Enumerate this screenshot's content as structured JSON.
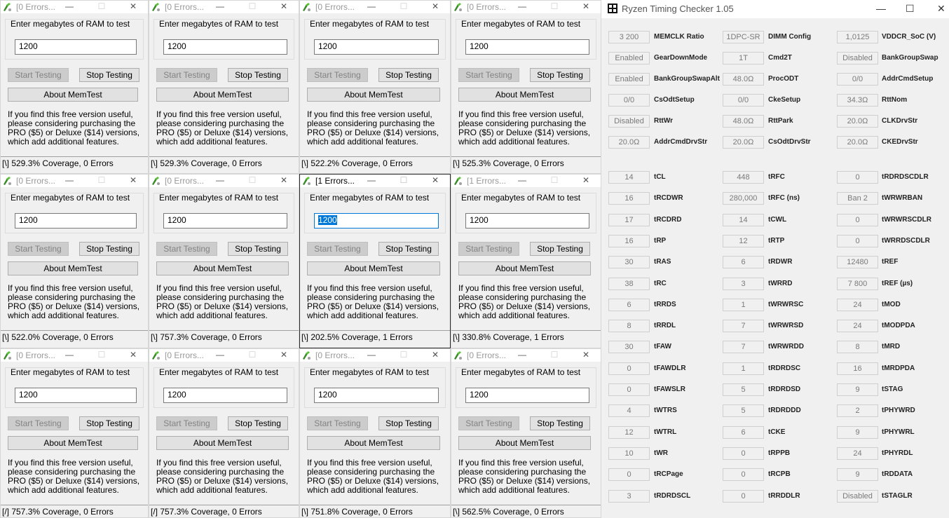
{
  "memtest": {
    "prompt": "Enter megabytes of RAM to test",
    "start_label": "Start Testing",
    "stop_label": "Stop Testing",
    "about_label": "About MemTest",
    "message": "If you find this free version useful, please considering purchasing the PRO ($5) or Deluxe ($14) versions, which add additional features.",
    "windows": [
      {
        "title": "[0 Errors...",
        "value": "1200",
        "status": "[\\]  529.3% Coverage, 0 Errors"
      },
      {
        "title": "[0 Errors...",
        "value": "1200",
        "status": "[\\]  529.3% Coverage, 0 Errors"
      },
      {
        "title": "[0 Errors...",
        "value": "1200",
        "status": "[\\]  522.2% Coverage, 0 Errors"
      },
      {
        "title": "[0 Errors...",
        "value": "1200",
        "status": "[\\]  525.3% Coverage, 0 Errors"
      },
      {
        "title": "[0 Errors...",
        "value": "1200",
        "status": "[\\]  522.0% Coverage, 0 Errors"
      },
      {
        "title": "[0 Errors...",
        "value": "1200",
        "status": "[\\]  757.3% Coverage, 0 Errors"
      },
      {
        "title": "[1 Errors...",
        "value": "1200",
        "status": "[\\]  202.5% Coverage, 1 Errors"
      },
      {
        "title": "[1 Errors...",
        "value": "1200",
        "status": "[\\]  330.8% Coverage, 1 Errors"
      },
      {
        "title": "[0 Errors...",
        "value": "1200",
        "status": "[/]  757.3% Coverage, 0 Errors"
      },
      {
        "title": "[0 Errors...",
        "value": "1200",
        "status": "[/]  757.3% Coverage, 0 Errors"
      },
      {
        "title": "[0 Errors...",
        "value": "1200",
        "status": "[\\]  751.8% Coverage, 0 Errors"
      },
      {
        "title": "[0 Errors...",
        "value": "1200",
        "status": "[\\]  562.5% Coverage, 0 Errors"
      }
    ]
  },
  "rtc": {
    "title": "Ryzen Timing Checker 1.05",
    "rows": [
      [
        {
          "v": "3 200",
          "l": "MEMCLK Ratio"
        },
        {
          "v": "1DPC-SR",
          "l": "DIMM Config"
        },
        {
          "v": "1,0125",
          "l": "VDDCR_SoC (V)"
        }
      ],
      [
        {
          "v": "Enabled",
          "l": "GearDownMode"
        },
        {
          "v": "1T",
          "l": "Cmd2T"
        },
        {
          "v": "Disabled",
          "l": "BankGroupSwap"
        }
      ],
      [
        {
          "v": "Enabled",
          "l": "BankGroupSwapAlt"
        },
        {
          "v": "48.0Ω",
          "l": "ProcODT"
        },
        {
          "v": "0/0",
          "l": "AddrCmdSetup"
        }
      ],
      [
        {
          "v": "0/0",
          "l": "CsOdtSetup"
        },
        {
          "v": "0/0",
          "l": "CkeSetup"
        },
        {
          "v": "34.3Ω",
          "l": "RttNom"
        }
      ],
      [
        {
          "v": "Disabled",
          "l": "RttWr"
        },
        {
          "v": "48.0Ω",
          "l": "RttPark"
        },
        {
          "v": "20.0Ω",
          "l": "CLKDrvStr"
        }
      ],
      [
        {
          "v": "20.0Ω",
          "l": "AddrCmdDrvStr"
        },
        {
          "v": "20.0Ω",
          "l": "CsOdtDrvStr"
        },
        {
          "v": "20.0Ω",
          "l": "CKEDrvStr"
        }
      ]
    ],
    "timings": [
      [
        {
          "v": "14",
          "l": "tCL"
        },
        {
          "v": "448",
          "l": "tRFC"
        },
        {
          "v": "0",
          "l": "tRDRDSCDLR"
        }
      ],
      [
        {
          "v": "16",
          "l": "tRCDWR"
        },
        {
          "v": "280,000",
          "l": "tRFC (ns)"
        },
        {
          "v": "Ban 2",
          "l": "tWRWRBAN"
        }
      ],
      [
        {
          "v": "17",
          "l": "tRCDRD"
        },
        {
          "v": "14",
          "l": "tCWL"
        },
        {
          "v": "0",
          "l": "tWRWRSCDLR"
        }
      ],
      [
        {
          "v": "16",
          "l": "tRP"
        },
        {
          "v": "12",
          "l": "tRTP"
        },
        {
          "v": "0",
          "l": "tWRRDSCDLR"
        }
      ],
      [
        {
          "v": "30",
          "l": "tRAS"
        },
        {
          "v": "6",
          "l": "tRDWR"
        },
        {
          "v": "12480",
          "l": "tREF"
        }
      ],
      [
        {
          "v": "38",
          "l": "tRC"
        },
        {
          "v": "3",
          "l": "tWRRD"
        },
        {
          "v": "7 800",
          "l": "tREF (µs)"
        }
      ],
      [
        {
          "v": "6",
          "l": "tRRDS"
        },
        {
          "v": "1",
          "l": "tWRWRSC"
        },
        {
          "v": "24",
          "l": "tMOD"
        }
      ],
      [
        {
          "v": "8",
          "l": "tRRDL"
        },
        {
          "v": "7",
          "l": "tWRWRSD"
        },
        {
          "v": "24",
          "l": "tMODPDA"
        }
      ],
      [
        {
          "v": "30",
          "l": "tFAW"
        },
        {
          "v": "7",
          "l": "tWRWRDD"
        },
        {
          "v": "8",
          "l": "tMRD"
        }
      ],
      [
        {
          "v": "0",
          "l": "tFAWDLR"
        },
        {
          "v": "1",
          "l": "tRDRDSC"
        },
        {
          "v": "16",
          "l": "tMRDPDA"
        }
      ],
      [
        {
          "v": "0",
          "l": "tFAWSLR"
        },
        {
          "v": "5",
          "l": "tRDRDSD"
        },
        {
          "v": "9",
          "l": "tSTAG"
        }
      ],
      [
        {
          "v": "4",
          "l": "tWTRS"
        },
        {
          "v": "5",
          "l": "tRDRDDD"
        },
        {
          "v": "2",
          "l": "tPHYWRD"
        }
      ],
      [
        {
          "v": "12",
          "l": "tWTRL"
        },
        {
          "v": "6",
          "l": "tCKE"
        },
        {
          "v": "9",
          "l": "tPHYWRL"
        }
      ],
      [
        {
          "v": "10",
          "l": "tWR"
        },
        {
          "v": "0",
          "l": "tRPPB"
        },
        {
          "v": "24",
          "l": "tPHYRDL"
        }
      ],
      [
        {
          "v": "0",
          "l": "tRCPage"
        },
        {
          "v": "0",
          "l": "tRCPB"
        },
        {
          "v": "9",
          "l": "tRDDATA"
        }
      ],
      [
        {
          "v": "3",
          "l": "tRDRDSCL"
        },
        {
          "v": "0",
          "l": "tRRDDLR"
        },
        {
          "v": "Disabled",
          "l": "tSTAGLR"
        }
      ]
    ]
  }
}
